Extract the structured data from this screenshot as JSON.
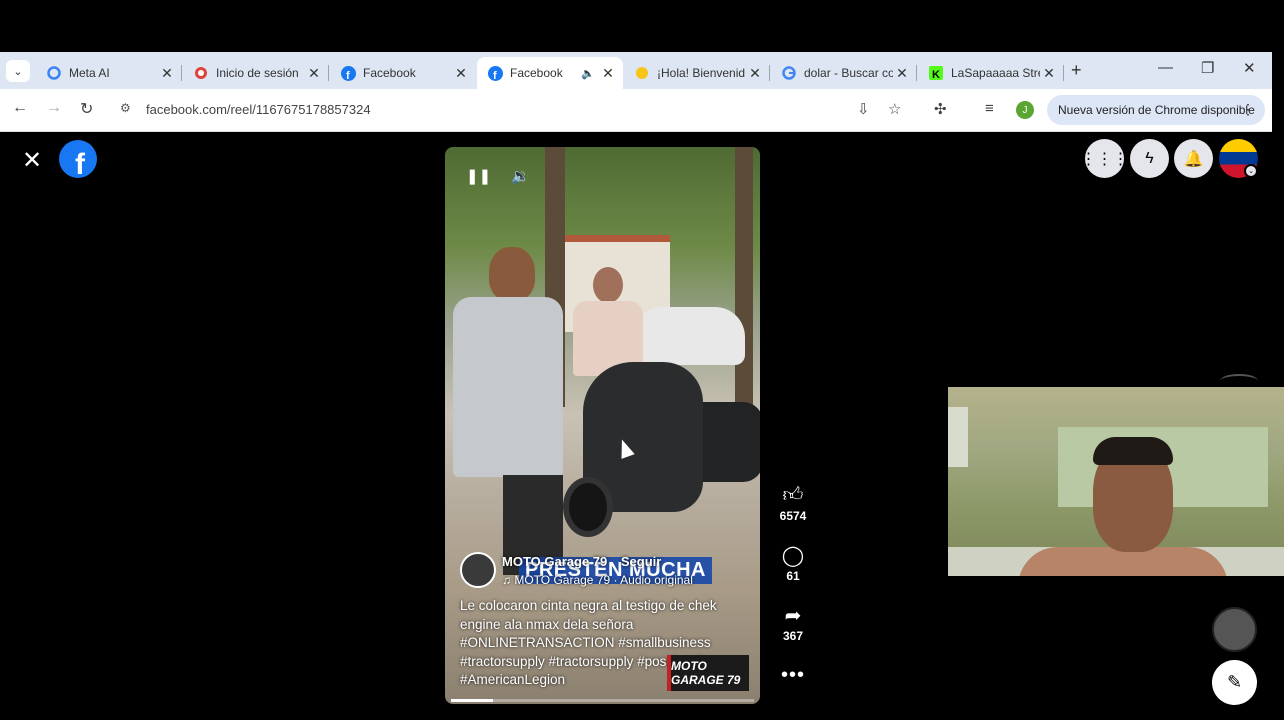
{
  "browser": {
    "tab_menu_icon": "chevron-down-icon",
    "tabs": [
      {
        "title": "Meta AI",
        "icon": "meta-ai-icon"
      },
      {
        "title": "Inicio de sesión",
        "icon": "login-icon"
      },
      {
        "title": "Facebook",
        "icon": "facebook-icon"
      },
      {
        "title": "Facebook",
        "icon": "facebook-icon",
        "active": true,
        "audio": true
      },
      {
        "title": "¡Hola! Bienvenid",
        "icon": "welcome-icon"
      },
      {
        "title": "dolar - Buscar co",
        "icon": "google-icon"
      },
      {
        "title": "LaSapaaaaa Stre",
        "icon": "kick-icon"
      }
    ],
    "url": "facebook.com/reel/1167675178857324",
    "profile_initial": "J",
    "update_label": "Nueva versión de Chrome disponible"
  },
  "reel": {
    "overlay_text": "PRESTEN MUCHA",
    "author": "MOTO Garage 79",
    "follow_label": "Seguir",
    "audio": "MOTO Garage 79 · Audio original",
    "caption": "Le colocaron cinta negra al testigo de chek engine ala nmax dela señora #ONLINETRANSACTION #smallbusiness #tractorsupply #tractorsupply #positivevibes #AmericanLegion",
    "watermark": "MOTO GARAGE 79",
    "progress": 0.14
  },
  "actions": {
    "likes": "6574",
    "comments": "61",
    "shares": "367"
  },
  "colors": {
    "facebook_blue": "#1877f2",
    "overlay_blue": "#1848a8",
    "tabbar": "#dee6f3"
  }
}
